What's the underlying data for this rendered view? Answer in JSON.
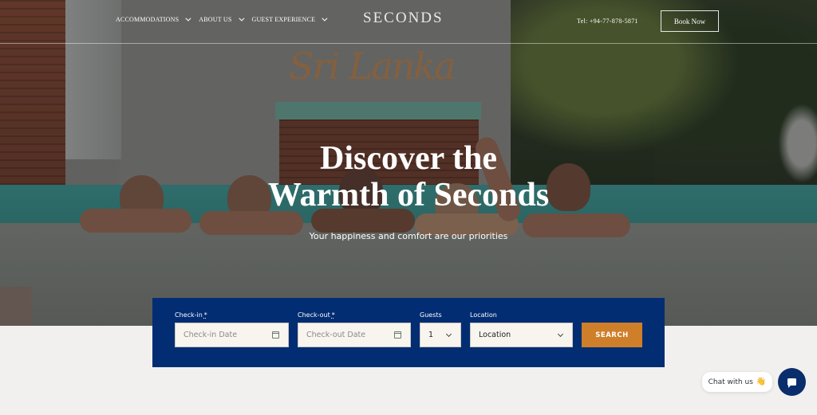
{
  "header": {
    "nav": [
      {
        "label": "ACCOMMODATIONS",
        "has_dropdown": true
      },
      {
        "label": "ABOUT US",
        "has_dropdown": true
      },
      {
        "label": "GUEST EXPERIENCE",
        "has_dropdown": true
      }
    ],
    "logo": "SECONDS",
    "phone": "Tel: +94-77-878-5871",
    "book_now_label": "Book Now"
  },
  "hero": {
    "background_sign_text": "Sri Lanka",
    "title_line1": "Discover the",
    "title_line2": "Warmth of Seconds",
    "subtitle": "Your happiness and comfort are our priorities"
  },
  "booking": {
    "checkin": {
      "label": "Check-in",
      "required_mark": "*",
      "placeholder": "Check-in Date",
      "value": "",
      "icon": "calendar-icon"
    },
    "checkout": {
      "label": "Check-out",
      "required_mark": "*",
      "placeholder": "Check-out Date",
      "value": "",
      "icon": "calendar-icon"
    },
    "guests": {
      "label": "Guests",
      "value": "1"
    },
    "location": {
      "label": "Location",
      "value": "Location"
    },
    "search_label": "SEARCH"
  },
  "chat": {
    "bubble_label": "Chat with us",
    "bubble_emoji": "👋",
    "button_icon": "chat-icon"
  },
  "colors": {
    "booking_bg": "#022d73",
    "search_button": "#cf7f29",
    "chat_button": "#0a2d6c",
    "page_bg": "#f1f0ee",
    "input_bg": "#f8f5ef"
  }
}
